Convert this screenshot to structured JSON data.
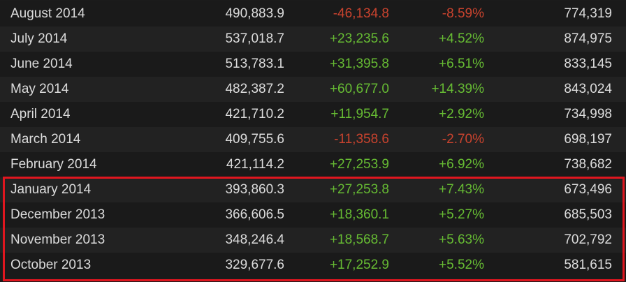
{
  "colors": {
    "positive": "#66bb33",
    "negative": "#c9432e",
    "highlight_border": "#e0161f",
    "text": "#dcdcdc"
  },
  "rows": [
    {
      "month": "August 2014",
      "avg": "490,883.9",
      "gain": "-46,134.8",
      "pct": "-8.59%",
      "peak": "774,319",
      "sign": "neg"
    },
    {
      "month": "July 2014",
      "avg": "537,018.7",
      "gain": "+23,235.6",
      "pct": "+4.52%",
      "peak": "874,975",
      "sign": "pos"
    },
    {
      "month": "June 2014",
      "avg": "513,783.1",
      "gain": "+31,395.8",
      "pct": "+6.51%",
      "peak": "833,145",
      "sign": "pos"
    },
    {
      "month": "May 2014",
      "avg": "482,387.2",
      "gain": "+60,677.0",
      "pct": "+14.39%",
      "peak": "843,024",
      "sign": "pos"
    },
    {
      "month": "April 2014",
      "avg": "421,710.2",
      "gain": "+11,954.7",
      "pct": "+2.92%",
      "peak": "734,998",
      "sign": "pos"
    },
    {
      "month": "March 2014",
      "avg": "409,755.6",
      "gain": "-11,358.6",
      "pct": "-2.70%",
      "peak": "698,197",
      "sign": "neg"
    },
    {
      "month": "February 2014",
      "avg": "421,114.2",
      "gain": "+27,253.9",
      "pct": "+6.92%",
      "peak": "738,682",
      "sign": "pos"
    },
    {
      "month": "January 2014",
      "avg": "393,860.3",
      "gain": "+27,253.8",
      "pct": "+7.43%",
      "peak": "673,496",
      "sign": "pos"
    },
    {
      "month": "December 2013",
      "avg": "366,606.5",
      "gain": "+18,360.1",
      "pct": "+5.27%",
      "peak": "685,503",
      "sign": "pos"
    },
    {
      "month": "November 2013",
      "avg": "348,246.4",
      "gain": "+18,568.7",
      "pct": "+5.63%",
      "peak": "702,792",
      "sign": "pos"
    },
    {
      "month": "October 2013",
      "avg": "329,677.6",
      "gain": "+17,252.9",
      "pct": "+5.52%",
      "peak": "581,615",
      "sign": "pos"
    }
  ]
}
